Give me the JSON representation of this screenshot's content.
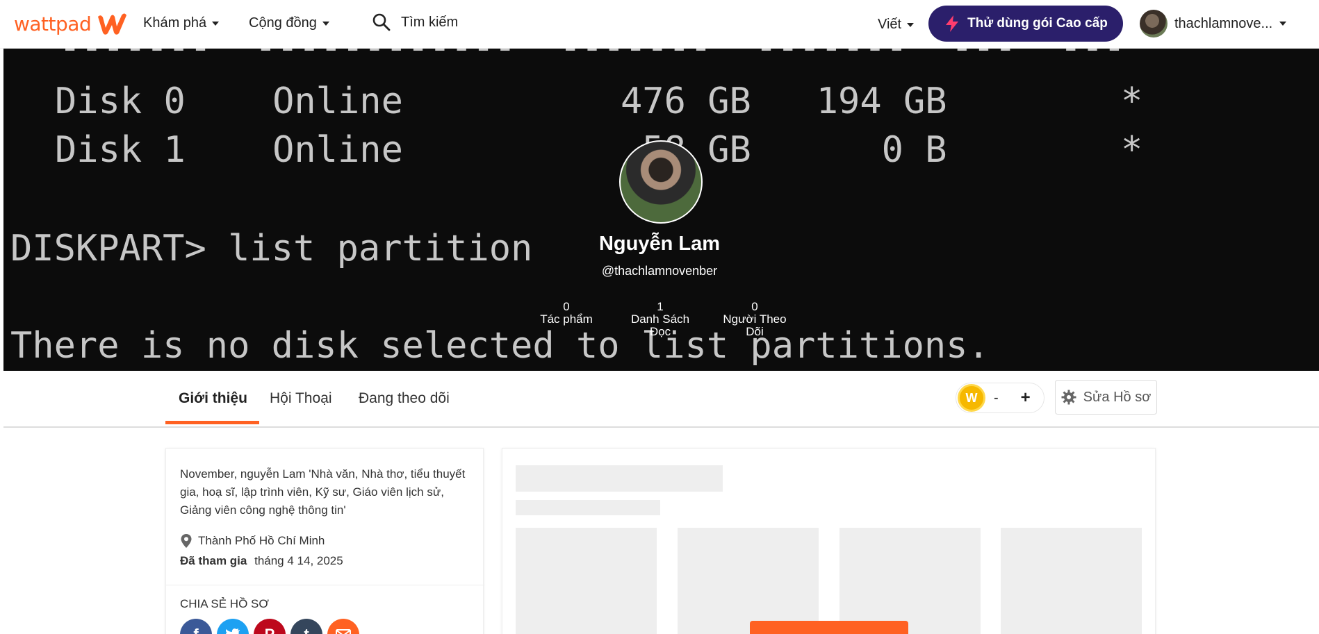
{
  "nav": {
    "logo_text": "wattpad",
    "explore": "Khám phá",
    "community": "Cộng đồng",
    "search_label": "Tìm kiếm",
    "write": "Viết",
    "premium": "Thử dùng gói Cao cấp",
    "username": "thachlamnove..."
  },
  "banner": {
    "line1": "-------  ------------  -------  -------  ---  ---",
    "disk0": "Disk 0    Online          476 GB   194 GB        *",
    "disk1": "Disk 1    Online           58 GB      0 B        *",
    "cmd": "DISKPART> list partition",
    "msg": "There is no disk selected to list partitions."
  },
  "profile": {
    "name": "Nguyễn Lam",
    "handle": "@thachlamnovenber",
    "stats": [
      {
        "value": "0",
        "label": "Tác phẩm"
      },
      {
        "value": "1",
        "label": "Danh Sách Đọc"
      },
      {
        "value": "0",
        "label": "Người Theo Dõi"
      }
    ]
  },
  "tabs": [
    "Giới thiệu",
    "Hội Thoại",
    "Đang theo dõi"
  ],
  "coins": {
    "symbol": "W",
    "value": "-",
    "add": "+"
  },
  "edit_profile": "Sửa Hồ sơ",
  "about": {
    "bio": "November, nguyễn Lam 'Nhà văn, Nhà thơ, tiểu thuyết gia, hoạ sĩ, lập trình viên, Kỹ sư, Giáo viên lịch sử, Giảng viên công nghệ thông tin'",
    "location": "Thành Phố Hồ Chí Minh",
    "joined_label": "Đã tham gia",
    "joined_date": "tháng 4 14, 2025",
    "share_title": "CHIA SẺ HỒ SƠ",
    "share_icons": [
      "facebook-icon",
      "twitter-icon",
      "pinterest-icon",
      "tumblr-icon",
      "email-icon"
    ]
  },
  "colors": {
    "brand": "#ff6122",
    "premium_bg": "#2b1f6b",
    "facebook": "#3b5998",
    "twitter": "#1da1f2",
    "pinterest": "#bd081c",
    "tumblr": "#35465c",
    "email": "#ff6122"
  }
}
